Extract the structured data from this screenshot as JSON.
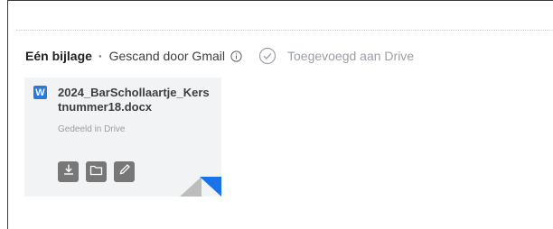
{
  "attachment_header": {
    "count_label": "Eén bijlage",
    "separator": "·",
    "scan_label": "Gescand door Gmail",
    "drive_status_label": "Toegevoegd aan Drive"
  },
  "attachment": {
    "file_type_icon_letter": "W",
    "file_name": "2024_BarSchollaartje_Kerstnummer18.docx",
    "shared_label": "Gedeeld in Drive",
    "actions": [
      "download-icon",
      "folder-icon",
      "edit-icon"
    ]
  },
  "colors": {
    "word_blue": "#2b79d7",
    "drive_blue": "#1a73e8",
    "action_gray": "#777777",
    "card_bg": "#f1f3f4"
  }
}
